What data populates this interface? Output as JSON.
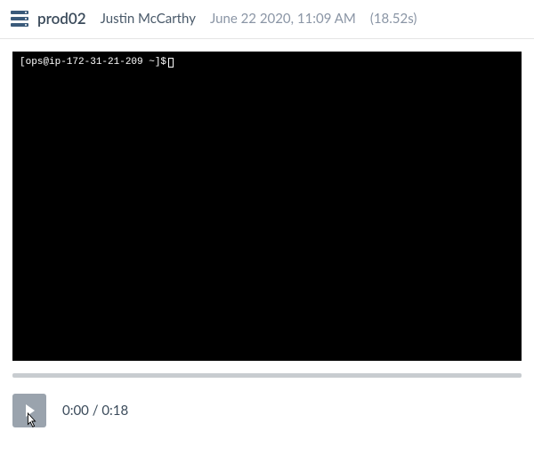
{
  "header": {
    "host": "prod02",
    "user": "Justin McCarthy",
    "timestamp": "June 22 2020, 11:09 AM",
    "duration": "(18.52s)"
  },
  "terminal": {
    "prompt": "[ops@ip-172-31-21-209 ~]$"
  },
  "player": {
    "current_time": "0:00",
    "total_time": "0:18",
    "separator": " / "
  }
}
